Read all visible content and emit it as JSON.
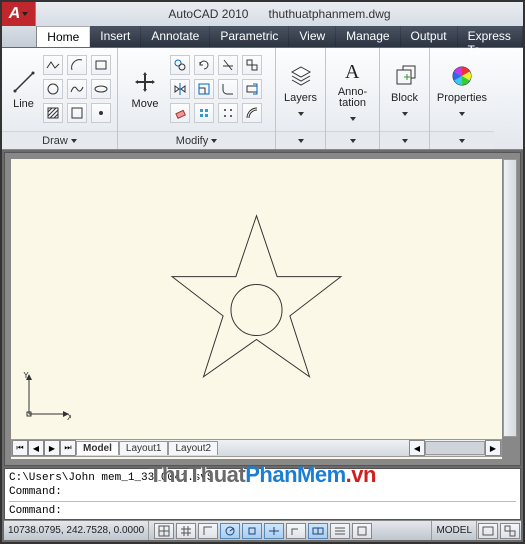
{
  "title": {
    "app": "AutoCAD 2010",
    "file": "thuthuatphanmem.dwg"
  },
  "appmenu": {
    "letter": "A"
  },
  "tabs": [
    "Home",
    "Insert",
    "Annotate",
    "Parametric",
    "View",
    "Manage",
    "Output",
    "Express To"
  ],
  "active_tab_index": 0,
  "ribbon": {
    "draw": {
      "label": "Draw",
      "line": "Line"
    },
    "modify": {
      "label": "Modify",
      "move": "Move"
    },
    "layers": {
      "label": "Layers"
    },
    "annotation": {
      "label": "Anno-",
      "label2": "tation"
    },
    "block": {
      "label": "Block"
    },
    "properties": {
      "label": "Properties"
    }
  },
  "layout_tabs": [
    "Model",
    "Layout1",
    "Layout2"
  ],
  "cmd": {
    "line1": "C:\\Users\\John                             mem_1_33_0041.sv$",
    "line2": "Command:",
    "line3": "Command:"
  },
  "status": {
    "coords": "10738.0795, 242.7528, 0.0000",
    "model": "MODEL"
  },
  "ucs": {
    "x": "X",
    "y": "Y"
  },
  "watermark": {
    "t1": "ThuThuat",
    "t2": "PhanMem",
    "t3": ".vn"
  }
}
